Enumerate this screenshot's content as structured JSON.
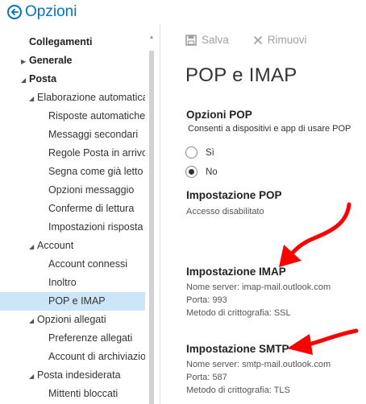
{
  "header": {
    "title": "Opzioni"
  },
  "sidebar": {
    "items": [
      {
        "label": "Collegamenti",
        "level": 0,
        "toggle": ""
      },
      {
        "label": "Generale",
        "level": 0,
        "toggle": "▶"
      },
      {
        "label": "Posta",
        "level": 0,
        "toggle": "◢"
      },
      {
        "label": "Elaborazione automatica",
        "level": 1,
        "toggle": "◢"
      },
      {
        "label": "Risposte automatiche",
        "level": 3,
        "toggle": ""
      },
      {
        "label": "Messaggi secondari",
        "level": 3,
        "toggle": ""
      },
      {
        "label": "Regole Posta in arrivo e",
        "level": 3,
        "toggle": ""
      },
      {
        "label": "Segna come già letto",
        "level": 3,
        "toggle": ""
      },
      {
        "label": "Opzioni messaggio",
        "level": 3,
        "toggle": ""
      },
      {
        "label": "Conferme di lettura",
        "level": 3,
        "toggle": ""
      },
      {
        "label": "Impostazioni risposta",
        "level": 3,
        "toggle": ""
      },
      {
        "label": "Account",
        "level": 1,
        "toggle": "◢"
      },
      {
        "label": "Account connessi",
        "level": 3,
        "toggle": ""
      },
      {
        "label": "Inoltro",
        "level": 3,
        "toggle": ""
      },
      {
        "label": "POP e IMAP",
        "level": 3,
        "toggle": "",
        "selected": true
      },
      {
        "label": "Opzioni allegati",
        "level": 1,
        "toggle": "◢"
      },
      {
        "label": "Preferenze allegati",
        "level": 3,
        "toggle": ""
      },
      {
        "label": "Account di archiviazione",
        "level": 3,
        "toggle": ""
      },
      {
        "label": "Posta indesiderata",
        "level": 1,
        "toggle": "◢"
      },
      {
        "label": "Mittenti bloccati",
        "level": 3,
        "toggle": ""
      }
    ]
  },
  "toolbar": {
    "save_label": "Salva",
    "remove_label": "Rimuovi"
  },
  "main": {
    "title": "POP e IMAP",
    "pop_options": {
      "title": "Opzioni POP",
      "description": "Consenti a dispositivi e app di usare POP",
      "options": [
        {
          "label": "Sì",
          "checked": false
        },
        {
          "label": "No",
          "checked": true
        }
      ]
    },
    "pop_setting": {
      "title": "Impostazione POP",
      "status": "Accesso disabilitato"
    },
    "imap_setting": {
      "title": "Impostazione IMAP",
      "server": "Nome server: imap-mail.outlook.com",
      "port": "Porta: 993",
      "encryption": "Metodo di crittografia: SSL"
    },
    "smtp_setting": {
      "title": "Impostazione SMTP",
      "server": "Nome server: smtp-mail.outlook.com",
      "port": "Porta: 587",
      "encryption": "Metodo di crittografia: TLS"
    }
  },
  "colors": {
    "accent": "#0072c6",
    "selection": "#cde6f7",
    "arrow": "#ff0000"
  },
  "icons": {
    "back": "back-arrow-circle-icon",
    "save": "floppy-disk-icon",
    "remove": "x-icon"
  }
}
